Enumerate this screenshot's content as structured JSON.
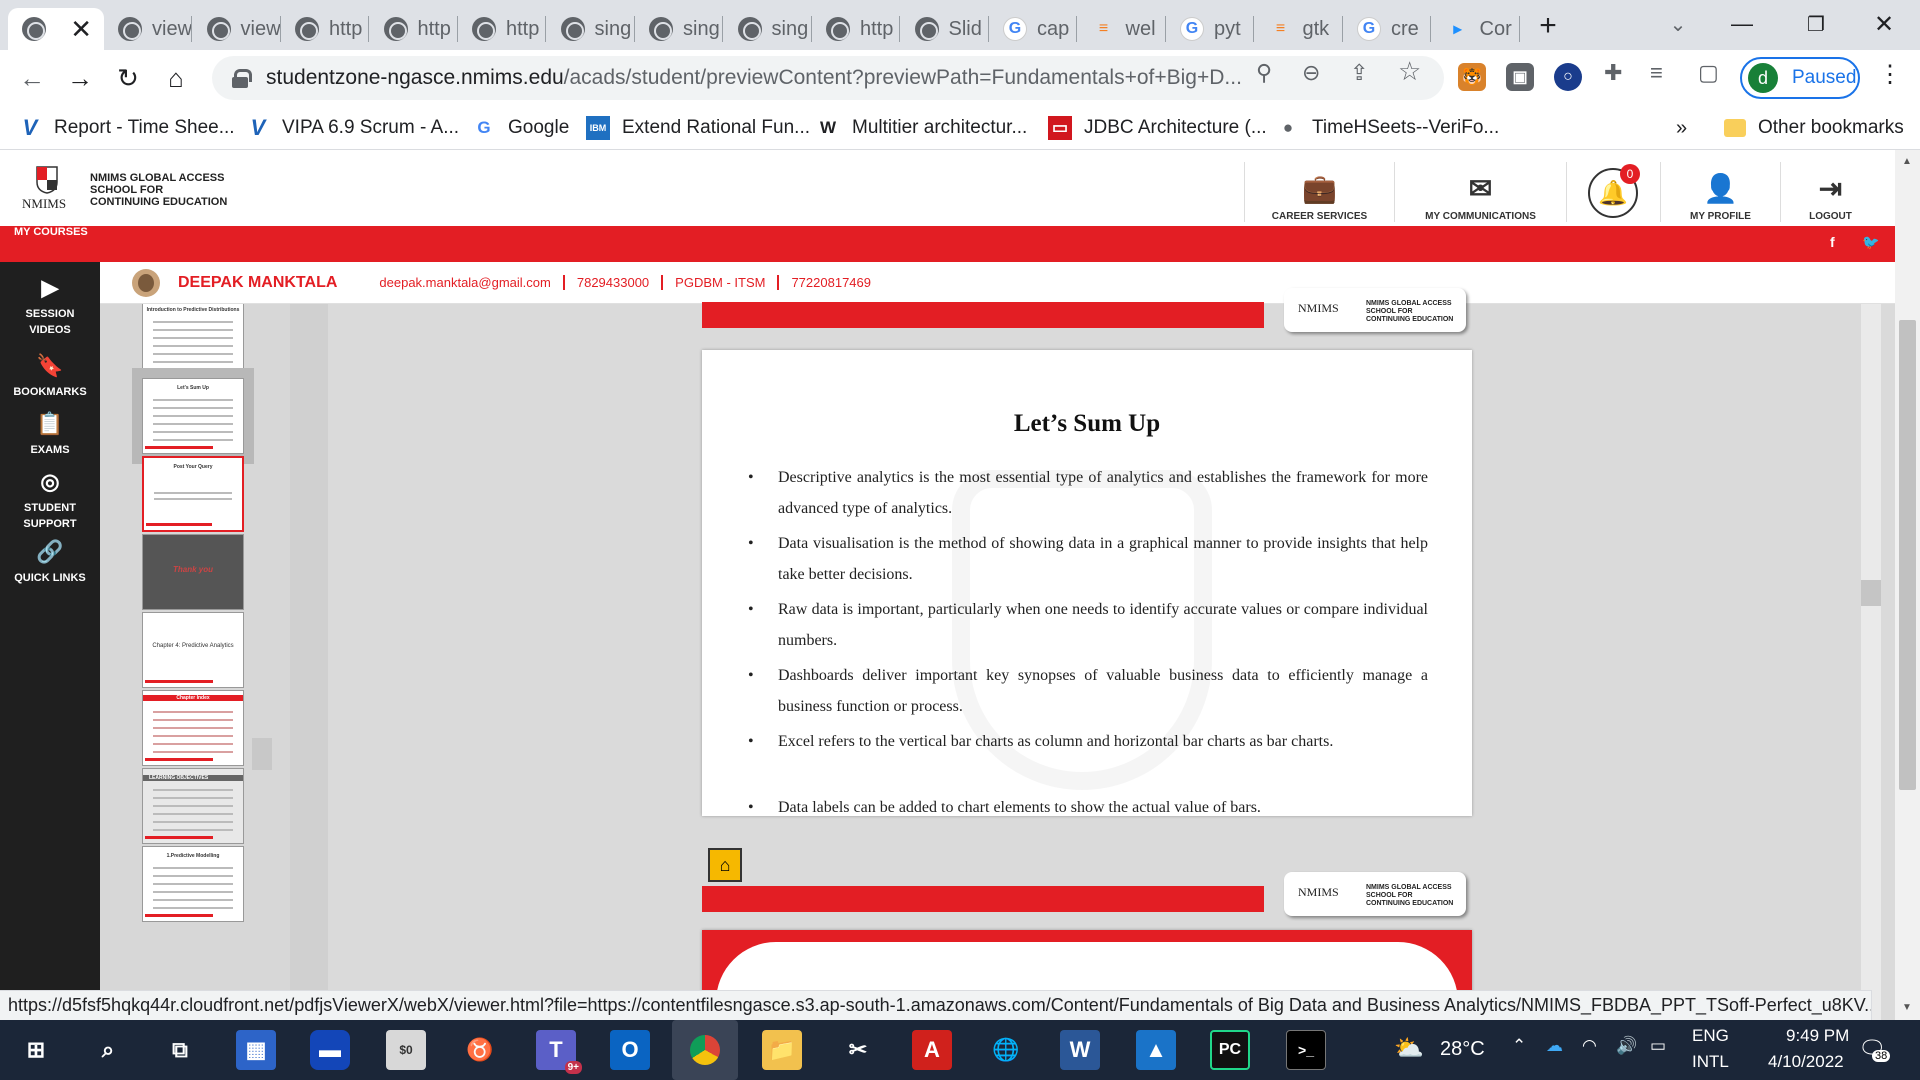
{
  "browser": {
    "tabs": [
      {
        "label": "",
        "icon": "globe-icon"
      },
      {
        "label": "view",
        "icon": "globe-icon"
      },
      {
        "label": "view",
        "icon": "globe-icon"
      },
      {
        "label": "http",
        "icon": "globe-icon"
      },
      {
        "label": "http",
        "icon": "globe-icon"
      },
      {
        "label": "http",
        "icon": "globe-icon"
      },
      {
        "label": "sing",
        "icon": "globe-icon"
      },
      {
        "label": "sing",
        "icon": "globe-icon"
      },
      {
        "label": "sing",
        "icon": "globe-icon"
      },
      {
        "label": "http",
        "icon": "globe-icon"
      },
      {
        "label": "Slid",
        "icon": "globe-icon"
      },
      {
        "label": "cap",
        "icon": "google-icon"
      },
      {
        "label": "wel",
        "icon": "stackoverflow-icon"
      },
      {
        "label": "pyt",
        "icon": "google-icon"
      },
      {
        "label": "gtk",
        "icon": "stackoverflow-icon"
      },
      {
        "label": "cre",
        "icon": "google-icon"
      },
      {
        "label": "Cor",
        "icon": "fish-icon"
      }
    ],
    "url_host": "studentzone-ngasce.nmims.edu",
    "url_path": "/acads/student/previewContent?previewPath=Fundamentals+of+Big+D...",
    "profile_label": "Paused",
    "profile_initial": "d",
    "bookmarks": [
      {
        "label": "Report - Time Shee...",
        "icon": "v-icon"
      },
      {
        "label": "VIPA 6.9 Scrum - A...",
        "icon": "v-icon"
      },
      {
        "label": "Google",
        "icon": "google-icon"
      },
      {
        "label": "Extend Rational Fun...",
        "icon": "ibm-icon"
      },
      {
        "label": "Multitier architectur...",
        "icon": "wikipedia-icon"
      },
      {
        "label": "JDBC Architecture (...",
        "icon": "jdbc-icon"
      },
      {
        "label": "TimeHSeets--VeriFo...",
        "icon": "globe-icon"
      }
    ],
    "bookmarks_more": "»",
    "other_bookmarks": "Other bookmarks",
    "status_url": "https://d5fsf5hqkq44r.cloudfront.net/pdfjsViewerX/webX/viewer.html?file=https://contentfilesngasce.s3.ap-south-1.amazonaws.com/Content/Fundamentals of Big Data and Business Analytics/NMIMS_FBDBA_PPT_TSoff-Perfect_u8KV..."
  },
  "portal": {
    "logo_text_1": "NMIMS GLOBAL ACCESS",
    "logo_text_2": "SCHOOL FOR",
    "logo_text_3": "CONTINUING EDUCATION",
    "logo_word": "NMIMS",
    "my_courses": "MY COURSES",
    "nav": {
      "career": "CAREER SERVICES",
      "communications": "MY COMMUNICATIONS",
      "notifications_count": "0",
      "profile": "MY PROFILE",
      "logout": "LOGOUT"
    },
    "social": {
      "facebook": "f",
      "twitter": "🐦"
    },
    "user": {
      "name": "DEEPAK MANKTALA",
      "email": "deepak.manktala@gmail.com",
      "phone": "7829433000",
      "program": "PGDBM - ITSM",
      "id": "77220817469"
    },
    "sidebar": [
      {
        "label": "SESSION VIDEOS",
        "icon": "play-icon"
      },
      {
        "label": "BOOKMARKS",
        "icon": "bookmark-icon"
      },
      {
        "label": "EXAMS",
        "icon": "exam-icon"
      },
      {
        "label": "STUDENT SUPPORT",
        "icon": "support-icon"
      },
      {
        "label": "QUICK LINKS",
        "icon": "link-icon"
      }
    ]
  },
  "viewer": {
    "thumbnails": [
      {
        "title": "Introduction to Predictive Distributions",
        "style": "text"
      },
      {
        "title": "Let's Sum Up",
        "style": "text",
        "selected": true
      },
      {
        "title": "Post Your Query",
        "style": "query"
      },
      {
        "title": "Thank you",
        "style": "dark"
      },
      {
        "title": "Chapter 4: Predictive Analytics",
        "style": "chapter"
      },
      {
        "title": "Chapter Index",
        "style": "table"
      },
      {
        "title": "LEARNING OBJECTIVES",
        "style": "objectives"
      },
      {
        "title": "1.Predictive Modelling",
        "style": "text"
      }
    ],
    "slide": {
      "title": "Let’s Sum Up",
      "bullets": [
        "Descriptive analytics is the most essential type of analytics and establishes the framework for more advanced type of analytics.",
        "Data visualisation is the method of showing data in a graphical manner to provide insights that help take better decisions.",
        "Raw data is important, particularly when one needs to identify accurate values or compare individual numbers.",
        "Dashboards deliver important key synopses of valuable business data to efficiently manage a business function or process.",
        "Excel refers to the vertical bar charts as column and horizontal bar charts as bar charts.",
        "Data labels can be added to chart elements to show the actual value of bars."
      ],
      "bullet_char": "•",
      "footer_logo_word": "NMIMS",
      "footer_logo_1": "NMIMS GLOBAL ACCESS",
      "footer_logo_2": "SCHOOL FOR",
      "footer_logo_3": "CONTINUING EDUCATION"
    }
  },
  "taskbar": {
    "weather": "28°C",
    "lang_1": "ENG",
    "lang_2": "INTL",
    "time": "9:49 PM",
    "date": "4/10/2022",
    "notif_count": "38",
    "teams_badge": "9+"
  }
}
